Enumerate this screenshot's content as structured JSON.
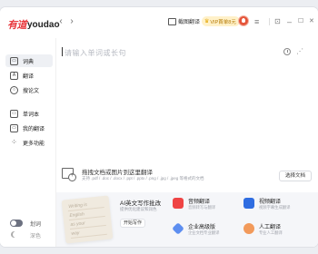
{
  "app": {
    "logo_cn": "有道",
    "logo_en": "youdao"
  },
  "titlebar": {
    "back_glyph": "‹",
    "forward_glyph": "›",
    "scan_label": "截图翻译",
    "vip_label": "VIP首单8元",
    "menu_glyph": "≡",
    "min_glyph": "–",
    "max_glyph": "☐",
    "close_glyph": "✕",
    "pin_glyph": "⊡"
  },
  "sidebar": {
    "items": [
      {
        "label": "词典",
        "icon": "dictionary-icon",
        "glyph": "▭",
        "active": true
      },
      {
        "label": "翻译",
        "icon": "translate-icon",
        "glyph": "A"
      },
      {
        "label": "搜论文",
        "icon": "paper-search-icon",
        "glyph": "○"
      },
      {
        "label": "单词本",
        "icon": "wordbook-icon",
        "glyph": "▭"
      },
      {
        "label": "我的翻译",
        "icon": "my-translation-icon",
        "glyph": "▭"
      },
      {
        "label": "更多功能",
        "icon": "more-features-icon",
        "glyph": "⁘"
      }
    ],
    "toggle_label": "划词",
    "theme_label": "深色"
  },
  "main": {
    "input_placeholder": "请输入单词或长句",
    "doc": {
      "title": "拖拽文档或图片到这里翻译",
      "formats": "支持 .pdf / .doc / .docx / .ppt / .pptx / .png / .jpg / .jpeg 等格式的文档",
      "button": "选择文档"
    }
  },
  "promo": {
    "notebook_lines": [
      "Writing is",
      "English",
      "as your",
      "way"
    ],
    "ai_title": "AI英文写作批改",
    "ai_sub": "提供优化建议和润色",
    "ai_button": "开始写作",
    "features": [
      {
        "title": "音频翻译",
        "sub": "音频转写与翻译",
        "color": "#ef4444",
        "icon": "audio-translate-icon"
      },
      {
        "title": "视频翻译",
        "sub": "视频字幕生成翻译",
        "color": "#2f6de1",
        "icon": "video-translate-icon"
      },
      {
        "title": "企业高级版",
        "sub": "企业文档专业翻译",
        "color": "#5d8ef0",
        "icon": "enterprise-icon"
      },
      {
        "title": "人工翻译",
        "sub": "专业人工翻译",
        "color": "#f29a5b",
        "icon": "human-translate-icon"
      }
    ]
  }
}
